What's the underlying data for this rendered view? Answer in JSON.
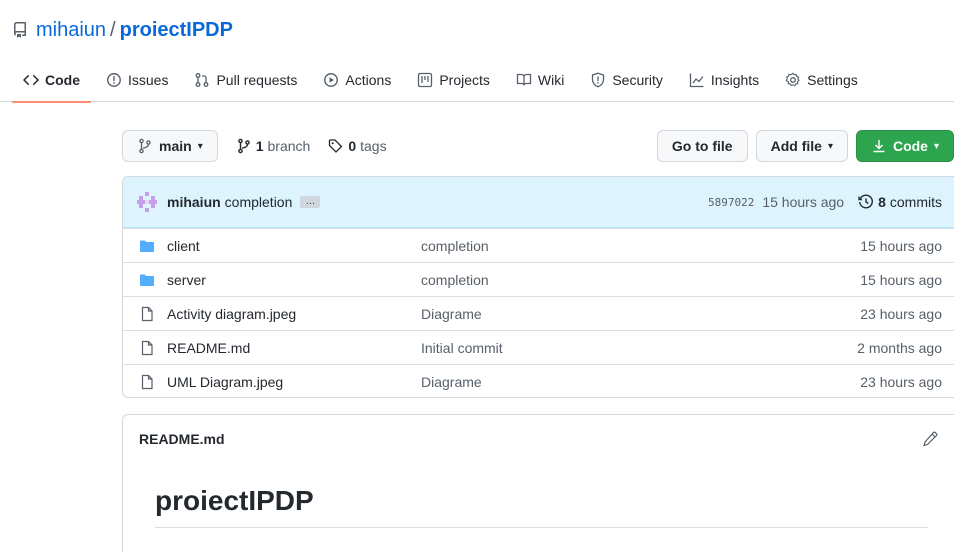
{
  "repo": {
    "owner": "mihaiun",
    "separator": "/",
    "name": "proiectIPDP"
  },
  "tabs": [
    {
      "label": "Code",
      "icon": "code-icon",
      "active": true
    },
    {
      "label": "Issues",
      "icon": "issue-icon"
    },
    {
      "label": "Pull requests",
      "icon": "pull-request-icon"
    },
    {
      "label": "Actions",
      "icon": "play-icon"
    },
    {
      "label": "Projects",
      "icon": "project-icon"
    },
    {
      "label": "Wiki",
      "icon": "book-icon"
    },
    {
      "label": "Security",
      "icon": "shield-icon"
    },
    {
      "label": "Insights",
      "icon": "graph-icon"
    },
    {
      "label": "Settings",
      "icon": "gear-icon"
    }
  ],
  "toolbar": {
    "branch": "main",
    "branch_count": "1",
    "branch_label": "branch",
    "tag_count": "0",
    "tag_label": "tags",
    "go_to_file": "Go to file",
    "add_file": "Add file",
    "code": "Code"
  },
  "commit": {
    "author": "mihaiun",
    "message": "completion",
    "ellipsis": "…",
    "sha": "5897022",
    "time": "15 hours ago",
    "commit_count": "8",
    "commit_label": "commits"
  },
  "files": [
    {
      "type": "folder",
      "name": "client",
      "commit": "completion",
      "age": "15 hours ago"
    },
    {
      "type": "folder",
      "name": "server",
      "commit": "completion",
      "age": "15 hours ago"
    },
    {
      "type": "file",
      "name": "Activity diagram.jpeg",
      "commit": "Diagrame",
      "age": "23 hours ago"
    },
    {
      "type": "file",
      "name": "README.md",
      "commit": "Initial commit",
      "age": "2 months ago"
    },
    {
      "type": "file",
      "name": "UML Diagram.jpeg",
      "commit": "Diagrame",
      "age": "23 hours ago"
    }
  ],
  "readme": {
    "filename": "README.md",
    "heading": "proiectIPDP"
  },
  "colors": {
    "accent": "#0969da",
    "green": "#2da44e",
    "tab_underline": "#fd8c73",
    "folder": "#54aeff",
    "commit_bar": "#ddf4ff"
  }
}
